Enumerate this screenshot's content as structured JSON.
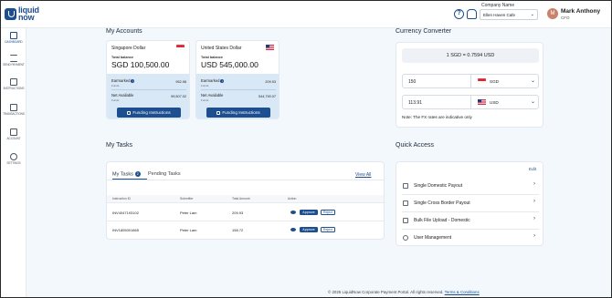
{
  "header": {
    "logo_line1": "liquid",
    "logo_line2": "now",
    "company_label": "Company Name",
    "company_value": "Ellen Haven Cafe",
    "user_initial": "M",
    "user_name": "Mark Anthony",
    "user_role": "CFO"
  },
  "sidebar": {
    "items": [
      {
        "label": "DASHBOARD",
        "icon": "dashboard-icon"
      },
      {
        "label": "SEND PAYMENT",
        "icon": "transfer-icon"
      },
      {
        "label": "INSTRUCTIONS",
        "icon": "document-icon"
      },
      {
        "label": "TRANSACTIONS",
        "icon": "transactions-icon"
      },
      {
        "label": "ACCOUNT",
        "icon": "account-icon"
      },
      {
        "label": "SETTINGS",
        "icon": "gear-icon"
      }
    ]
  },
  "accounts": {
    "title": "My Accounts",
    "cards": [
      {
        "currency": "Singapore Dollar",
        "total_label": "Total balance",
        "balance": "SGD 100,500.00",
        "earmarked_label": "Earmarked",
        "earmarked_sub": "Funds",
        "earmarked": "952.98",
        "available_label": "Net Available",
        "available_sub": "Funds",
        "available": "99,507.02",
        "button": "Funding Instructions",
        "flag": "sg"
      },
      {
        "currency": "United States Dollar",
        "total_label": "Total balance",
        "balance": "USD 545,000.00",
        "earmarked_label": "Earmarked",
        "earmarked_sub": "Funds",
        "earmarked": "209.93",
        "available_label": "Net Available",
        "available_sub": "Funds",
        "available": "544,790.07",
        "button": "Funding Instructions",
        "flag": "us"
      }
    ]
  },
  "converter": {
    "title": "Currency Converter",
    "rate": "1 SGD = 0.7594 USD",
    "from_amount": "150",
    "from_currency": "SGD",
    "to_amount": "113.91",
    "to_currency": "USD",
    "note": "Note: The FX rates are indicative only"
  },
  "tasks": {
    "title": "My Tasks",
    "tab_mine": "My Tasks",
    "tab_mine_count": "2",
    "tab_pending": "Pending Tasks",
    "view_all": "View All",
    "columns": [
      "Instruction ID",
      "Submitter",
      "Total Amount",
      "Action"
    ],
    "rows": [
      {
        "id": "INV4047193102",
        "submitter": "Peter Lam",
        "amount": "209.93",
        "approve": "Approve",
        "reject": "Reject"
      },
      {
        "id": "INV1805001865",
        "submitter": "Peter Lam",
        "amount": "158.72",
        "approve": "Approve",
        "reject": "Reject"
      }
    ]
  },
  "quick_access": {
    "title": "Quick Access",
    "edit": "Edit",
    "items": [
      "Single Domestic Payout",
      "Single Cross Border Payout",
      "Bulk File Upload - Domestic",
      "User Management"
    ]
  },
  "footer": {
    "text": "© 2025 LiquidNow Corporate Payment Portal. All rights reserved.",
    "link": "Terms & Conditions"
  },
  "colors": {
    "brand": "#1d4e8f",
    "page_bg": "#f3f8fd",
    "card_lower": "#d9e8f6"
  }
}
